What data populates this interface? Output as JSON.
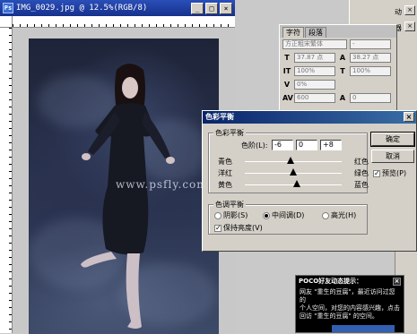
{
  "document": {
    "title": "IMG_0029.jpg @ 12.5%(RGB/8)",
    "ps_icon": "Ps",
    "watermark": "www.psfly.com"
  },
  "window_buttons": {
    "minimize": "_",
    "maximize": "□",
    "close": "×"
  },
  "right_panels": {
    "history_fragment_1": "动",
    "history_fragment_2": "器"
  },
  "character_panel": {
    "tabs": [
      "字符",
      "段落"
    ],
    "font_family": "方正粗宋繁体",
    "font_style": "-",
    "font_size": "37.87 点",
    "leading": "38.27 点",
    "vertical_scale": "100%",
    "horizontal_scale": "100%",
    "kerning": "0%",
    "tracking": "600",
    "baseline": "0",
    "tracking_small": "0"
  },
  "color_balance": {
    "title": "色彩平衡",
    "section_balance": "色彩平衡",
    "levels_label": "色阶(L):",
    "levels": [
      "-6",
      "0",
      "+8"
    ],
    "sliders": [
      {
        "left": "青色",
        "right": "红色",
        "value": -6
      },
      {
        "left": "洋红",
        "right": "绿色",
        "value": 0
      },
      {
        "left": "黄色",
        "right": "蓝色",
        "value": 8
      }
    ],
    "section_tone": "色调平衡",
    "tones": [
      {
        "label": "阴影(S)",
        "selected": false
      },
      {
        "label": "中间调(D)",
        "selected": true
      },
      {
        "label": "高光(H)",
        "selected": false
      }
    ],
    "preserve_luminosity": "保持亮度(V)",
    "ok": "确定",
    "cancel": "取消",
    "preview": "预览(P)"
  },
  "popup": {
    "title": "POCO好友动态提示：",
    "close": "×",
    "lines": [
      "网友 \"重生的豆腐\"，最近访问过您的",
      "个人空间，对您的内容感兴趣，点击",
      "回访 \"重生的豆腐\" 的空间。"
    ]
  }
}
